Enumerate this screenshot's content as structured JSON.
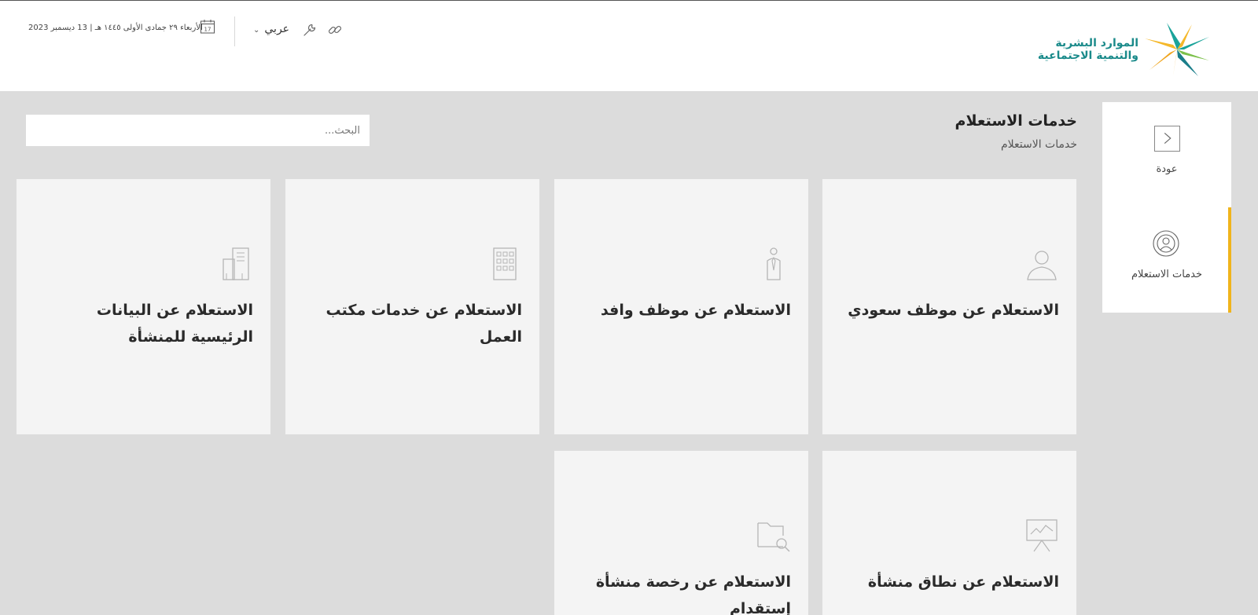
{
  "header": {
    "logo": {
      "line1": "الموارد البشرية",
      "line2": "والتنمية الاجتماعية"
    },
    "date_text": "الأربعاء ٢٩ جمادى الأولى ١٤٤٥ هـ | 13 ديسمبر 2023",
    "calendar_day": "17",
    "language": "عربي",
    "icons": [
      "calendar-icon",
      "chevron-down-icon",
      "wrench-icon",
      "link-icon"
    ]
  },
  "sidenav": {
    "items": [
      {
        "label": "عودة",
        "icon": "chevron-right-icon"
      },
      {
        "label": "خدمات الاستعلام",
        "icon": "broadcast-icon",
        "active": true
      }
    ],
    "accent_color": "#f0b41c"
  },
  "page": {
    "title": "خدمات الاستعلام",
    "breadcrumb": "خدمات الاستعلام"
  },
  "search": {
    "placeholder": "البحث...",
    "value": ""
  },
  "cards": [
    {
      "title": "الاستعلام عن موظف سعودي",
      "icon": "user-icon"
    },
    {
      "title": "الاستعلام عن موظف وافد",
      "icon": "person-tie-icon"
    },
    {
      "title": "الاستعلام عن خدمات مكتب العمل",
      "icon": "building-icon"
    },
    {
      "title": "الاستعلام عن البيانات الرئيسية للمنشأة",
      "icon": "buildings-icon"
    },
    {
      "title": "الاستعلام عن نطاق منشأة",
      "icon": "presentation-chart-icon"
    },
    {
      "title": "الاستعلام عن رخصة منشأة إستقدام",
      "icon": "folder-search-icon"
    }
  ],
  "colors": {
    "background": "#dcdcdc",
    "card": "#f4f4f4",
    "brand_teal": "#1a8a8a",
    "accent": "#f0b41c"
  }
}
